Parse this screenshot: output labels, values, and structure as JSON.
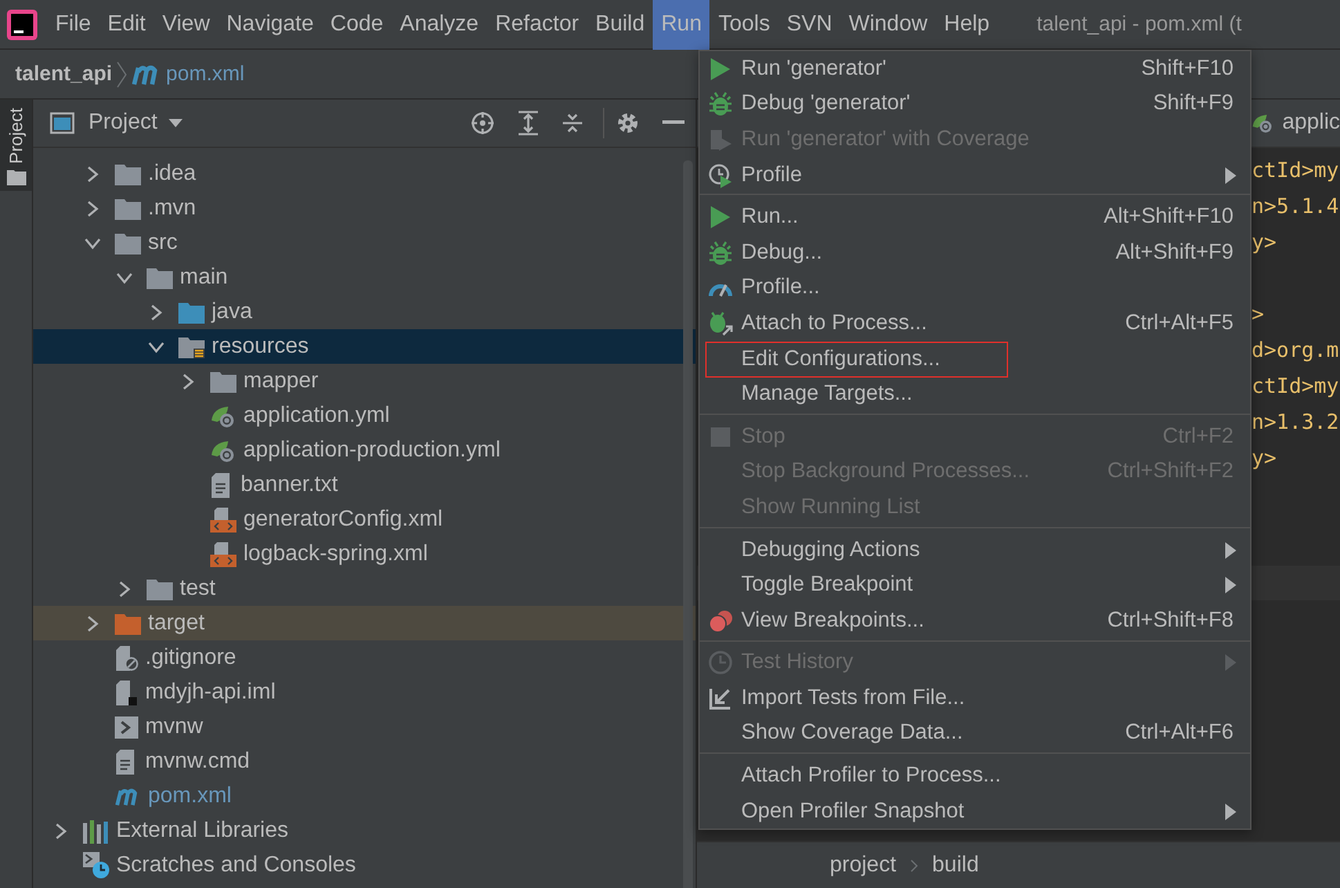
{
  "menu_bar": {
    "items": [
      {
        "label": "File",
        "selected": false
      },
      {
        "label": "Edit",
        "selected": false
      },
      {
        "label": "View",
        "selected": false
      },
      {
        "label": "Navigate",
        "selected": false
      },
      {
        "label": "Code",
        "selected": false
      },
      {
        "label": "Analyze",
        "selected": false
      },
      {
        "label": "Refactor",
        "selected": false
      },
      {
        "label": "Build",
        "selected": false
      },
      {
        "label": "Run",
        "selected": true
      },
      {
        "label": "Tools",
        "selected": false
      },
      {
        "label": "SVN",
        "selected": false
      },
      {
        "label": "Window",
        "selected": false
      },
      {
        "label": "Help",
        "selected": false
      }
    ],
    "title": "talent_api - pom.xml (t"
  },
  "breadcrumb": {
    "project": "talent_api",
    "file": "pom.xml"
  },
  "side_strip": {
    "label": "Project"
  },
  "project_panel": {
    "title": "Project",
    "items": [
      {
        "label": ".idea",
        "kind": "folder",
        "expanded": false,
        "selected": false
      },
      {
        "label": ".mvn",
        "kind": "folder",
        "expanded": false,
        "selected": false
      },
      {
        "label": "src",
        "kind": "folder",
        "expanded": true,
        "selected": false,
        "children": [
          {
            "label": "main",
            "kind": "folder",
            "expanded": true,
            "selected": false,
            "children": [
              {
                "label": "java",
                "kind": "source",
                "expanded": false,
                "selected": false
              },
              {
                "label": "resources",
                "kind": "resources",
                "expanded": true,
                "selected": true,
                "children": [
                  {
                    "label": "mapper",
                    "kind": "folder",
                    "expanded": false,
                    "selected": false
                  },
                  {
                    "label": "application.yml",
                    "kind": "spring",
                    "selected": false
                  },
                  {
                    "label": "application-production.yml",
                    "kind": "spring",
                    "selected": false
                  },
                  {
                    "label": "banner.txt",
                    "kind": "text",
                    "selected": false
                  },
                  {
                    "label": "generatorConfig.xml",
                    "kind": "xml",
                    "selected": false
                  },
                  {
                    "label": "logback-spring.xml",
                    "kind": "xml",
                    "selected": false
                  }
                ]
              }
            ]
          },
          {
            "label": "test",
            "kind": "folder",
            "expanded": false,
            "selected": false
          }
        ]
      },
      {
        "label": "target",
        "kind": "excluded",
        "expanded": false,
        "selected": false
      },
      {
        "label": ".gitignore",
        "kind": "ignore",
        "selected": false
      },
      {
        "label": "mdyjh-api.iml",
        "kind": "module",
        "selected": false
      },
      {
        "label": "mvnw",
        "kind": "shell",
        "selected": false
      },
      {
        "label": "mvnw.cmd",
        "kind": "text",
        "selected": false
      },
      {
        "label": "pom.xml",
        "kind": "maven",
        "selected": false
      }
    ],
    "other_items": [
      {
        "label": "External Libraries",
        "kind": "libraries",
        "expanded": false,
        "selected": false
      },
      {
        "label": "Scratches and Consoles",
        "kind": "scratches",
        "selected": false
      }
    ]
  },
  "editor": {
    "tab": "applic",
    "lines": [
      "ctId>my",
      "n>5.1.4",
      "y>",
      ">",
      "d>org.m",
      "ctId>my",
      "n>1.3.2",
      "y>"
    ],
    "breadcrumbs": [
      "project",
      "build"
    ]
  },
  "run_menu": [
    {
      "kind": "run",
      "label": "Run 'generator'",
      "shortcut": "Shift+F10",
      "disabled": false
    },
    {
      "kind": "debug",
      "label": "Debug 'generator'",
      "shortcut": "Shift+F9",
      "disabled": false
    },
    {
      "kind": "coverage",
      "label": "Run 'generator' with Coverage",
      "disabled": true
    },
    {
      "kind": "profile",
      "label": "Profile",
      "disabled": false,
      "submenu": true
    },
    {
      "kind": "separator"
    },
    {
      "kind": "run",
      "label": "Run...",
      "shortcut": "Alt+Shift+F10",
      "disabled": false
    },
    {
      "kind": "debug",
      "label": "Debug...",
      "shortcut": "Alt+Shift+F9",
      "disabled": false
    },
    {
      "kind": "gauge",
      "label": "Profile...",
      "disabled": false
    },
    {
      "kind": "attach",
      "label": "Attach to Process...",
      "shortcut": "Ctrl+Alt+F5",
      "disabled": false
    },
    {
      "kind": "plain",
      "label": "Edit Configurations...",
      "disabled": false,
      "outlined": true
    },
    {
      "kind": "plain",
      "label": "Manage Targets...",
      "disabled": false
    },
    {
      "kind": "separator"
    },
    {
      "kind": "stop",
      "label": "Stop",
      "shortcut": "Ctrl+F2",
      "disabled": true
    },
    {
      "kind": "plain",
      "label": "Stop Background Processes...",
      "shortcut": "Ctrl+Shift+F2",
      "disabled": true
    },
    {
      "kind": "plain",
      "label": "Show Running List",
      "disabled": true
    },
    {
      "kind": "separator"
    },
    {
      "kind": "plain",
      "label": "Debugging Actions",
      "disabled": false,
      "submenu": true
    },
    {
      "kind": "plain",
      "label": "Toggle Breakpoint",
      "disabled": false,
      "submenu": true
    },
    {
      "kind": "breakpoints",
      "label": "View Breakpoints...",
      "shortcut": "Ctrl+Shift+F8",
      "disabled": false
    },
    {
      "kind": "separator"
    },
    {
      "kind": "history",
      "label": "Test History",
      "disabled": true,
      "submenu": true
    },
    {
      "kind": "import",
      "label": "Import Tests from File...",
      "disabled": false
    },
    {
      "kind": "plain",
      "label": "Show Coverage Data...",
      "shortcut": "Ctrl+Alt+F6",
      "disabled": false
    },
    {
      "kind": "separator"
    },
    {
      "kind": "plain",
      "label": "Attach Profiler to Process...",
      "disabled": false
    },
    {
      "kind": "plain",
      "label": "Open Profiler Snapshot",
      "disabled": false,
      "submenu": true
    }
  ]
}
